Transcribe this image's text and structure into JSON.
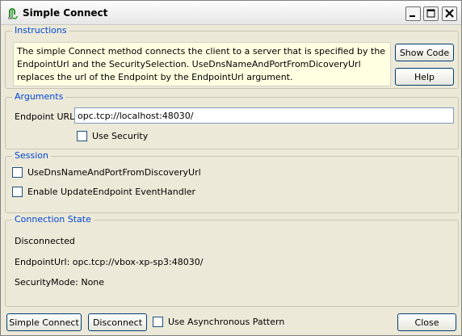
{
  "window": {
    "title": "Simple Connect"
  },
  "instructions": {
    "label": "Instructions",
    "lines": [
      "The simple Connect method connects the client to a server that is specified by the",
      "EndpointUrl and the SecuritySelection. UseDnsNameAndPortFromDicoveryUrl",
      "replaces the url of the Endpoint by the EndpointUrl argument."
    ],
    "show_code_label": "Show Code",
    "help_label": "Help"
  },
  "arguments": {
    "label": "Arguments",
    "endpoint_url_label": "Endpoint URL",
    "endpoint_url_value": "opc.tcp://localhost:48030/",
    "use_security_label": "Use Security",
    "use_security_checked": false
  },
  "session": {
    "label": "Session",
    "use_dns_label": "UseDnsNameAndPortFromDiscoveryUrl",
    "use_dns_checked": false,
    "update_endpoint_label": "Enable UpdateEndpoint EventHandler",
    "update_endpoint_checked": false
  },
  "connection_state": {
    "label": "Connection State",
    "status": "Disconnected",
    "endpoint_url": "EndpointUrl: opc.tcp://vbox-xp-sp3:48030/",
    "security_mode": "SecurityMode: None"
  },
  "footer": {
    "simple_connect_label": "Simple Connect",
    "disconnect_label": "Disconnect",
    "async_label": "Use Asynchronous Pattern",
    "async_checked": false,
    "close_label": "Close"
  },
  "colors": {
    "group_label": "#0046d5",
    "instructions_bg": "#ffffe1",
    "window_bg": "#ece9d8"
  },
  "icons": [
    "app-icon",
    "minimize-icon",
    "maximize-icon",
    "close-icon"
  ]
}
